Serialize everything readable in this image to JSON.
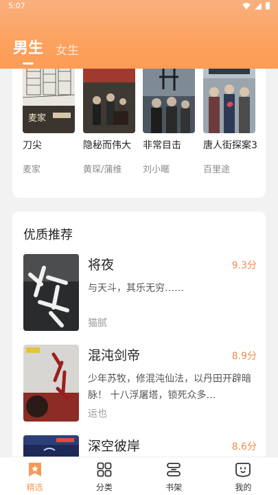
{
  "status": {
    "time": "5:07"
  },
  "tabs": [
    {
      "label": "男生"
    },
    {
      "label": "女生"
    }
  ],
  "top_books": [
    {
      "title": "刀尖",
      "author": "麦家",
      "cover_text": "麦家"
    },
    {
      "title": "隐秘而伟大",
      "author": "黄琛/蒲维"
    },
    {
      "title": "非常目击",
      "author": "刘小暱"
    },
    {
      "title": "唐人街探案3",
      "author": "百里途"
    }
  ],
  "section": {
    "title": "优质推荐"
  },
  "recommendations": [
    {
      "title": "将夜",
      "score": "9.3分",
      "desc": "与天斗，其乐无穷……",
      "author": "猫腻"
    },
    {
      "title": "混沌剑帝",
      "score": "8.9分",
      "desc": "少年苏牧，修混沌仙法，以丹田开辟暗脉！ 十八浮屠塔，锁死众多…",
      "author": "运也"
    },
    {
      "title": "深空彼岸",
      "score": "8.6分"
    }
  ],
  "bottom_nav": [
    {
      "label": "精选",
      "icon": "bookmark-icon"
    },
    {
      "label": "分类",
      "icon": "grid-icon"
    },
    {
      "label": "书架",
      "icon": "shelf-icon"
    },
    {
      "label": "我的",
      "icon": "profile-icon"
    }
  ],
  "colors": {
    "accent": "#f59a56",
    "score": "#f08a4b",
    "header": "#fca25f"
  }
}
